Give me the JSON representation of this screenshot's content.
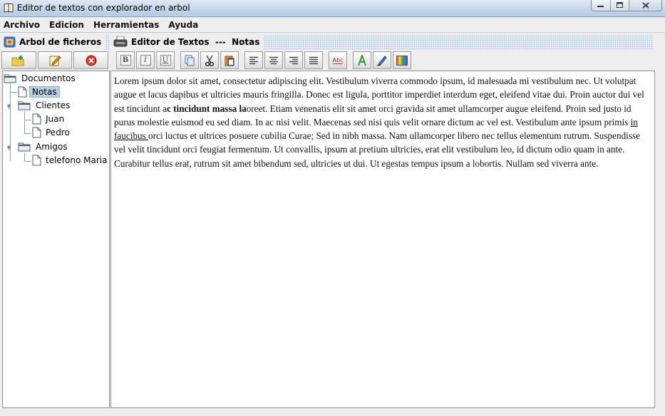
{
  "window": {
    "title": "Editor de textos con explorador en arbol"
  },
  "menu": {
    "items": [
      "Archivo",
      "Edicion",
      "Herramientas",
      "Ayuda"
    ]
  },
  "left_panel": {
    "title": "Arbol de ficheros",
    "toolbar": [
      "new-folder-icon",
      "edit-note-icon",
      "delete-icon"
    ]
  },
  "right_panel": {
    "title": "Editor de Textos  ---  Notas"
  },
  "format_toolbar": {
    "bold": "B",
    "italic": "I",
    "underline": "U",
    "spell": "Abc"
  },
  "tree": {
    "root": "Documentos",
    "notas": "Notas",
    "clientes": "Clientes",
    "juan": "Juan",
    "pedro": "Pedro",
    "amigos": "Amigos",
    "telefono": "telefono Maria"
  },
  "document": {
    "part1": "Lorem ipsum dolor sit amet, consectetur adipiscing elit. Vestibulum viverra commodo ipsum, id malesuada mi vestibulum nec. Ut volutpat augue et lacus dapibus et ultricies mauris fringilla. Donec est ligula, porttitor imperdiet interdum eget, eleifend vitae dui. Proin auctor dui vel est tincidunt a",
    "bold": "c tincidunt massa la",
    "part2": "oreet. Etiam venenatis elit sit amet orci gravida sit amet ullamcorper augue eleifend. Proin sed justo id purus molestie euismod eu sed diam. In ac nisi velit. Maecenas sed nisi quis velit ornare dictum ac vel est. Vestibulum ante ipsum primis ",
    "underline": "in faucibus ",
    "part3": "orci luctus et ultrices posuere cubilia Curae; Sed in nibh massa. Nam ullamcorper libero nec tellus elementum rutrum. Suspendisse vel velit tincidunt orci feugiat fermentum. Ut convallis, ipsum at pretium ultricies, erat elit vestibulum leo, id dictum odio quam in ante. Curabitur tellus erat, rutrum sit amet bibendum sed, ultricies ut dui. Ut egestas tempus ipsum a lobortis. Nullam sed viverra ante."
  }
}
